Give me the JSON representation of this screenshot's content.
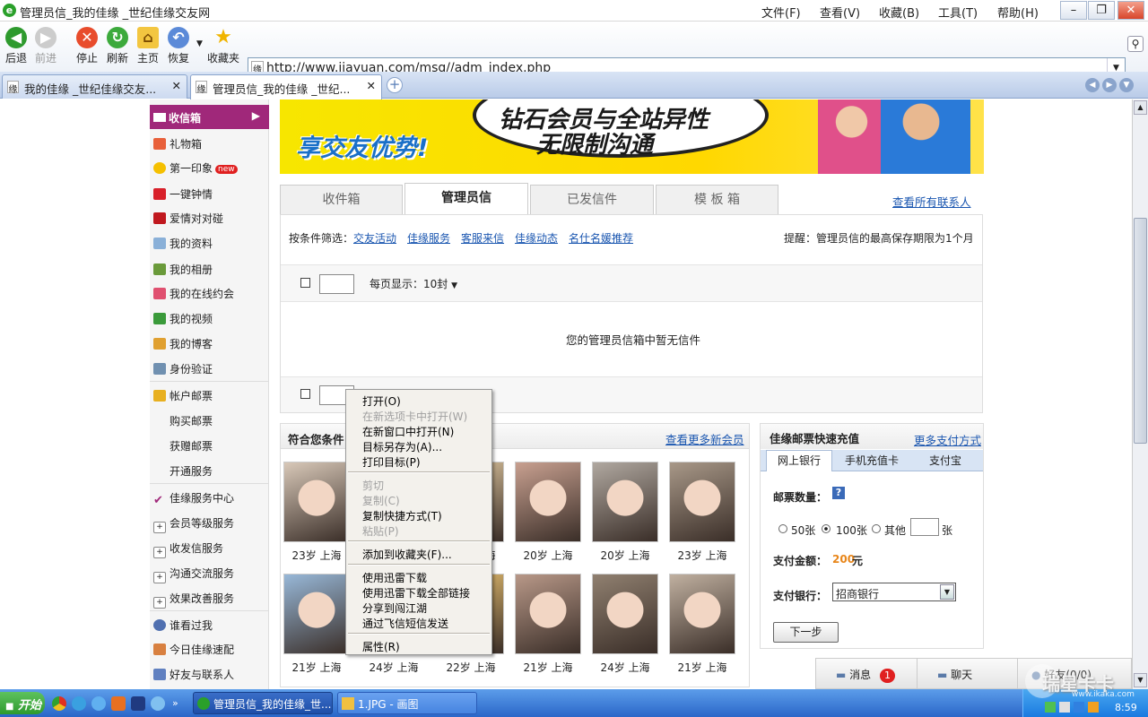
{
  "window": {
    "title": "管理员信_我的佳缘 _世纪佳缘交友网",
    "menu": [
      "文件(F)",
      "查看(V)",
      "收藏(B)",
      "工具(T)",
      "帮助(H)"
    ]
  },
  "toolbar": {
    "back": "后退",
    "forward": "前进",
    "stop": "停止",
    "refresh": "刷新",
    "home": "主页",
    "restore": "恢复",
    "favorites": "收藏夹"
  },
  "address": {
    "url": "http://www.jiayuan.com/msg//adm_index.php"
  },
  "browser_tabs": [
    {
      "label": "我的佳缘 _世纪佳缘交友..."
    },
    {
      "label": "管理员信_我的佳缘 _世纪..."
    }
  ],
  "sidebar": {
    "items": [
      {
        "label": "收信箱"
      },
      {
        "label": "礼物箱"
      },
      {
        "label": "第一印象",
        "badge": "new"
      },
      {
        "label": "一键钟情"
      },
      {
        "label": "爱情对对碰"
      },
      {
        "label": "我的资料"
      },
      {
        "label": "我的相册"
      },
      {
        "label": "我的在线约会"
      },
      {
        "label": "我的视频"
      },
      {
        "label": "我的博客"
      },
      {
        "label": "身份验证"
      },
      {
        "label": "帐户邮票"
      },
      {
        "label": "购买邮票"
      },
      {
        "label": "获赠邮票"
      },
      {
        "label": "开通服务"
      },
      {
        "label": "佳缘服务中心"
      },
      {
        "label": "会员等级服务"
      },
      {
        "label": "收发信服务"
      },
      {
        "label": "沟通交流服务"
      },
      {
        "label": "效果改善服务"
      },
      {
        "label": "谁看过我"
      },
      {
        "label": "今日佳缘速配"
      },
      {
        "label": "好友与联系人"
      }
    ]
  },
  "banner": {
    "line1": "钻石会员与全站异性",
    "line2": "无限制沟通",
    "slogan": "享交友优势!"
  },
  "mail": {
    "tabs": [
      "收件箱",
      "管理员信",
      "已发信件",
      "模 板 箱"
    ],
    "view_all_contacts": "查看所有联系人",
    "filter_label": "按条件筛选：",
    "filters": [
      "交友活动",
      "佳缘服务",
      "客服来信",
      "佳缘动态",
      "名仕名媛推荐"
    ],
    "reminder": "提醒：管理员信的最高保存期限为1个月",
    "per_page": "每页显示：10封",
    "empty_message": "您的管理员信箱中暂无信件"
  },
  "members": {
    "title": "符合您条件",
    "more": "查看更多新会员",
    "profiles": [
      "23岁 上海",
      "22岁 上海",
      "20岁 上海",
      "20岁 上海",
      "20岁 上海",
      "23岁 上海",
      "21岁 上海",
      "24岁 上海",
      "22岁 上海",
      "21岁 上海",
      "24岁 上海",
      "21岁 上海"
    ]
  },
  "recharge": {
    "title": "佳缘邮票快速充值",
    "more": "更多支付方式",
    "tabs": [
      "网上银行",
      "手机充值卡",
      "支付宝"
    ],
    "quantity_label": "邮票数量：",
    "options": [
      "50张",
      "100张",
      "其他"
    ],
    "unit": "张",
    "amount_label": "支付金额：",
    "amount_value": "200",
    "amount_unit": "元",
    "bank_label": "支付银行：",
    "bank_selected": "招商银行",
    "next_button": "下一步"
  },
  "context_menu": {
    "items": [
      {
        "label": "打开(O)",
        "enabled": true
      },
      {
        "label": "在新选项卡中打开(W)",
        "enabled": false
      },
      {
        "label": "在新窗口中打开(N)",
        "enabled": true
      },
      {
        "label": "目标另存为(A)...",
        "enabled": true
      },
      {
        "label": "打印目标(P)",
        "enabled": true
      },
      {
        "label": "剪切",
        "enabled": false
      },
      {
        "label": "复制(C)",
        "enabled": false
      },
      {
        "label": "复制快捷方式(T)",
        "enabled": true
      },
      {
        "label": "粘贴(P)",
        "enabled": false
      },
      {
        "label": "添加到收藏夹(F)...",
        "enabled": true
      },
      {
        "label": "使用迅雷下载",
        "enabled": true
      },
      {
        "label": "使用迅雷下载全部链接",
        "enabled": true
      },
      {
        "label": "分享到闯江湖",
        "enabled": true
      },
      {
        "label": "通过飞信短信发送",
        "enabled": true
      },
      {
        "label": "属性(R)",
        "enabled": true
      }
    ]
  },
  "chat_bar": {
    "messages": "消息",
    "message_count": "1",
    "chat": "聊天",
    "friends": "好友(0/0)"
  },
  "taskbar": {
    "start": "开始",
    "windows": [
      "管理员信_我的佳缘_世...",
      "1.JPG - 画图"
    ],
    "clock": "8:59",
    "watermark": "瑞星卡卡",
    "watermark_url": "www.ikaka.com"
  },
  "colors": {
    "sidebar_active": "#a0287a",
    "link": "#1a56b0",
    "banner": "#ffd800",
    "taskbar": "#2a66c8"
  }
}
